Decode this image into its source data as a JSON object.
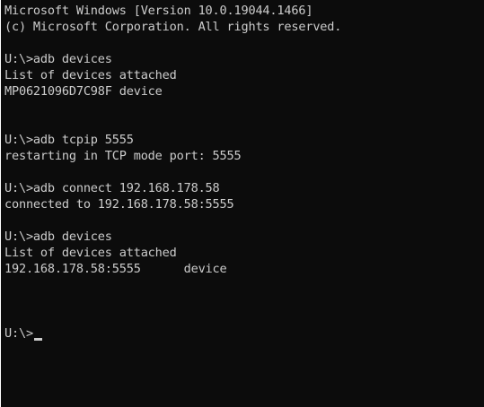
{
  "terminal": {
    "lines": [
      "Microsoft Windows [Version 10.0.19044.1466]",
      "(c) Microsoft Corporation. All rights reserved.",
      "",
      "U:\\>adb devices",
      "List of devices attached",
      "MP0621096D7C98F device",
      "",
      "",
      "U:\\>adb tcpip 5555",
      "restarting in TCP mode port: 5555",
      "",
      "U:\\>adb connect 192.168.178.58",
      "connected to 192.168.178.58:5555",
      "",
      "U:\\>adb devices",
      "List of devices attached",
      "192.168.178.58:5555      device",
      "",
      "",
      ""
    ],
    "prompt": "U:\\>",
    "text_color": "#cccccc",
    "background_color": "#0c0c0c"
  }
}
